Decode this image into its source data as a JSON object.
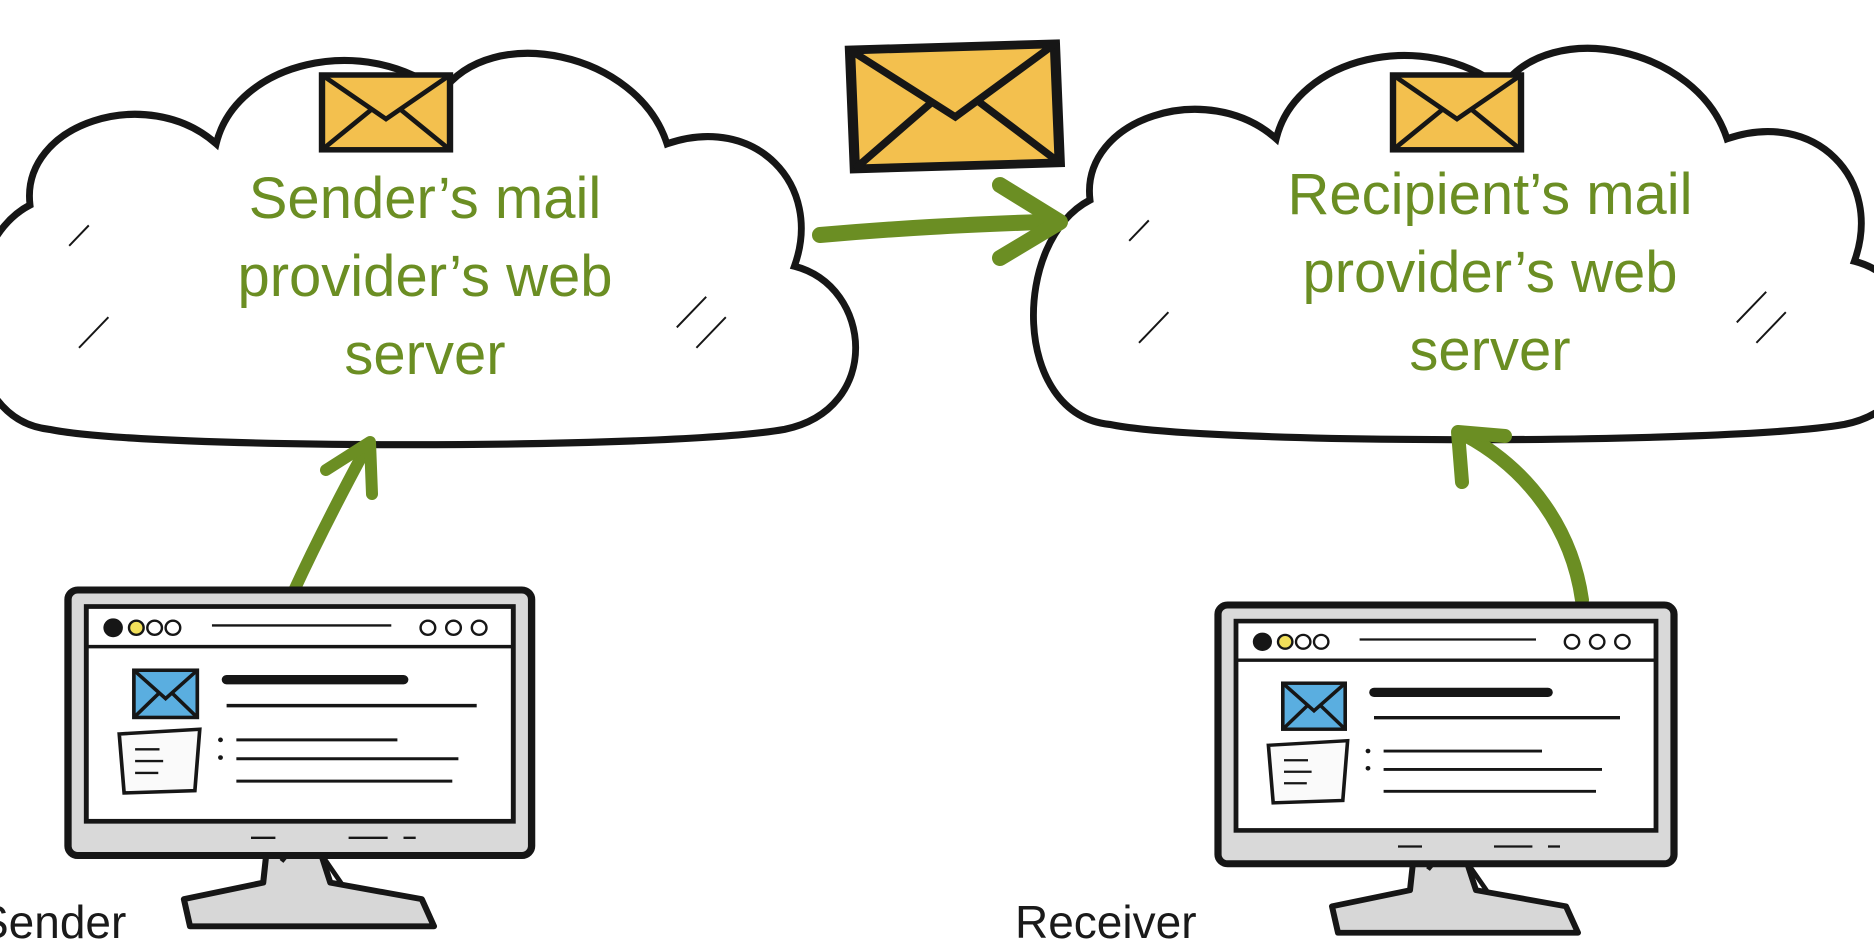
{
  "colors": {
    "accent": "#6b8e23",
    "outline": "#161616",
    "envelope": "#f3c04e",
    "mail_icon": "#5aaee0",
    "screen_frame": "#d9d9d9"
  },
  "sender_server": {
    "icon": "envelope-icon",
    "lines": [
      "Sender’s mail",
      "provider’s web",
      "server"
    ]
  },
  "recipient_server": {
    "icon": "envelope-icon",
    "lines": [
      "Recipient’s mail",
      "provider’s web",
      "server"
    ]
  },
  "transfer": {
    "icon": "envelope-icon"
  },
  "sender_device": {
    "label": "Sender",
    "icon": "monitor-icon"
  },
  "receiver_device": {
    "label": "Receiver",
    "icon": "monitor-icon"
  }
}
